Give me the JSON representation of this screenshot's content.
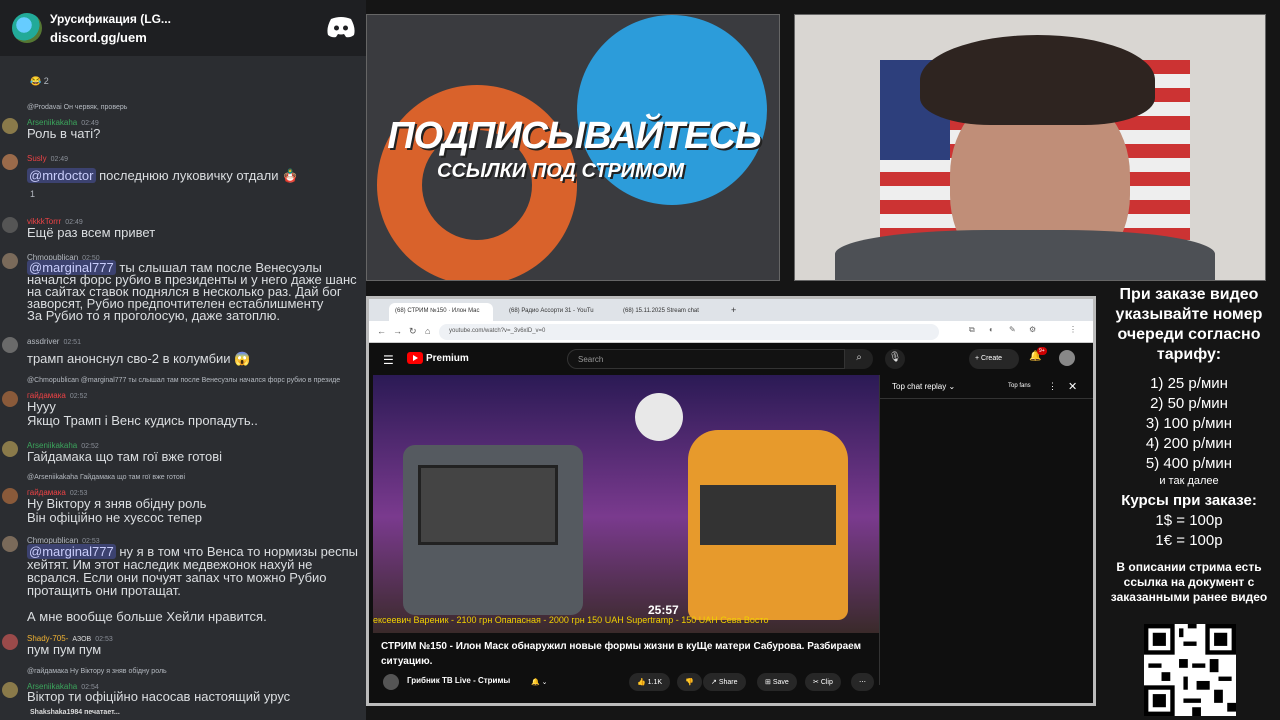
{
  "chat": {
    "server_title": "Урусификация (LG...",
    "server_sub": "discord.gg/uem",
    "reaction_top": "😂 2",
    "messages": [
      {
        "reply": "@Prodavai Он червяк, проверь",
        "name": "Arseniikakaha",
        "name_color": "#3ba55c",
        "time": "02:49",
        "text": "Роль в чаті?"
      },
      {
        "name": "Susly",
        "name_color": "#ed4245",
        "time": "02:49",
        "mention": "@mrdoctor",
        "text": " последнюю луковичку отдали 🪆",
        "react": "1"
      },
      {
        "name": "vikkkTorrr",
        "name_color": "#ed4245",
        "time": "02:49",
        "text": "Ещё раз всем привет"
      },
      {
        "name": "Chmopublican",
        "name_color": "#b5bac1",
        "time": "02:50",
        "mention": "@marginal777",
        "text": " ты слышал там после Венесуэлы начался форс рубио в президенты и у него даже шанс на сайтах ставок поднялся в несколько раз. Дай бог заворсят, Рубио предпочтителен естаблишменту\nЗа Рубио то я проголосую, даже затоплю."
      },
      {
        "name": "assdriver",
        "name_color": "#b5bac1",
        "time": "02:51",
        "text": "трамп анонснул сво-2 в колумбии 😱"
      },
      {
        "reply": "@Chmopublican @marginal777 ты слышал там после Венесуэлы начался форс рубио в президе",
        "name": "гайдамака",
        "name_color": "#ed4245",
        "time": "02:52",
        "text": "Нууу\nЯкщо Трамп і Венс кудись пропадуть.."
      },
      {
        "name": "Arseniikakaha",
        "name_color": "#3ba55c",
        "time": "02:52",
        "text": "Гайдамака що там гої вже готові"
      },
      {
        "reply": "@Arseniikakaha Гайдамака що там гої вже готові",
        "name": "гайдамака",
        "name_color": "#ed4245",
        "time": "02:53",
        "text": "Ну Віктору я зняв обідну роль\nВін офіційно не хуєсос тепер"
      },
      {
        "name": "Chmopublican",
        "name_color": "#b5bac1",
        "time": "02:53",
        "mention": "@marginal777",
        "text": " ну я в том что Венса то нормизы респы хейтят. Им этот наследик медвежонок нахуй не всрался. Если они почуят запах что можно Рубио протащить они протащат.\n\nА мне вообще больше Хейли нравится."
      },
      {
        "name": "Shady-705-",
        "name_color": "#f0b232",
        "tag": "АЗОВ",
        "time": "02:53",
        "text": "пум пум пум"
      },
      {
        "reply": "@гайдамака Ну Віктору я зняв обідну роль",
        "name": "Arseniikakaha",
        "name_color": "#3ba55c",
        "time": "02:54",
        "text": "Віктор ти офіційно насосав настоящий урус"
      }
    ],
    "typing": "Shakshaka1984 печатает..."
  },
  "banner": {
    "title": "ПОДПИСЫВАЙТЕСЬ",
    "subtitle": "ССЫЛКИ ПОД СТРИМОМ"
  },
  "browser": {
    "tabs": [
      "(68) СТРИМ №150 · Илон Мас",
      "(68) Радио Ассорти 31 - YouTu",
      "(68) 15.11.2025 Stream chat"
    ],
    "url": "youtube.com/watch?v=_3v6xlD_v=0"
  },
  "youtube": {
    "brand": "Premium",
    "search_placeholder": "Search",
    "create_label": "Create",
    "notif_count": "9+",
    "chat_title": "Top chat replay",
    "top_fans": "Top fans",
    "video_time": "25:57",
    "ticker": "ексеевич Вареник - 2100 грн   Опапасная - 2000 грн 150 UAH   Supertramp - 150 UAH   Сева Восто",
    "video_title": "СТРИМ №150 - Илон Маск обнаружил новые формы жизни в куЩе матери Сабурова. Разбираем ситуацию.",
    "channel": "Грибник ТВ Live - Стримы",
    "likes": "1.1K",
    "share": "Share",
    "save": "Save",
    "clip": "Clip"
  },
  "info": {
    "header": "При заказе видео указывайте номер очереди согласно тарифу:",
    "tariffs": [
      "1) 25 р/мин",
      "2) 50 р/мин",
      "3) 100 р/мин",
      "4) 200 р/мин",
      "5) 400 р/мин"
    ],
    "etc": "и так далее",
    "rates_title": "Курсы при заказе:",
    "rates": [
      "1$ = 100р",
      "1€ = 100р"
    ],
    "description": "В описании стрима есть ссылка на документ с заказанными ранее видео"
  }
}
